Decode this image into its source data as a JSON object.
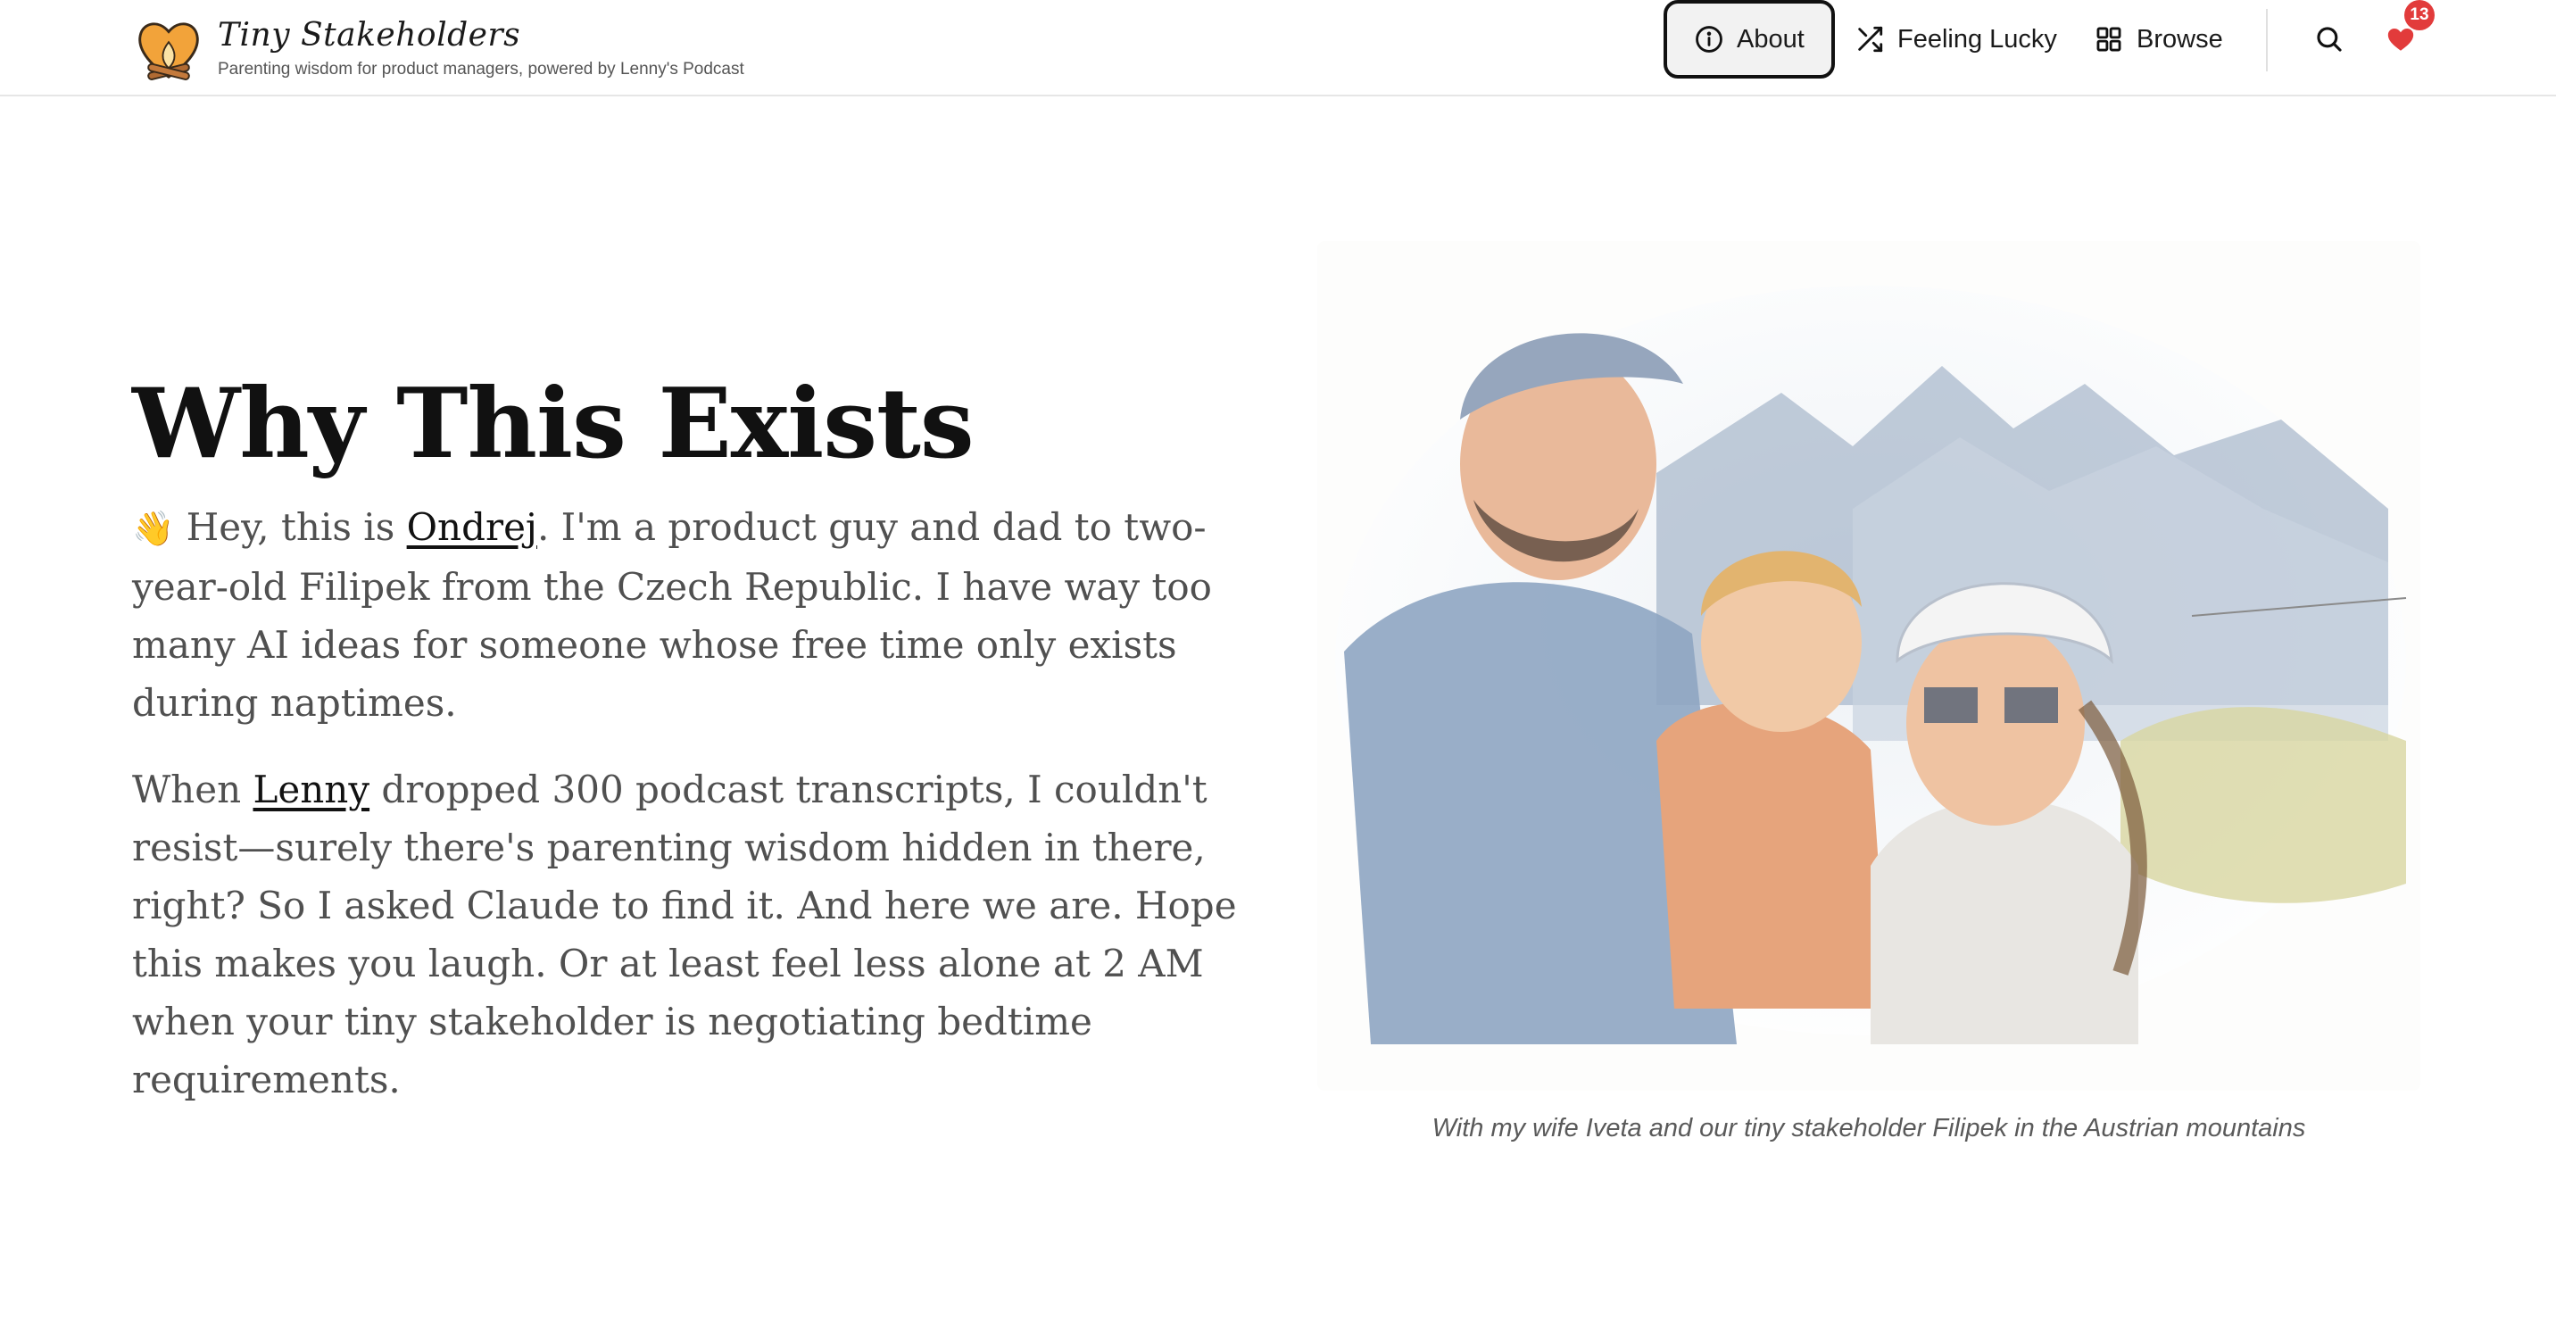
{
  "brand": {
    "title": "Tiny Stakeholders",
    "tagline": "Parenting wisdom for product managers, powered by Lenny's Podcast",
    "logo_icon": "heart-campfire-icon"
  },
  "nav": {
    "about": "About",
    "feeling_lucky": "Feeling Lucky",
    "browse": "Browse",
    "favorites_count": "13"
  },
  "colors": {
    "accent_red": "#e23b3b",
    "text_dark": "#111111",
    "text_body": "#505050"
  },
  "main": {
    "title": "Why This Exists",
    "p1": {
      "emoji": "👋",
      "before_link": " Hey, this is ",
      "link": "Ondrej",
      "after_link": ". I'm a product guy and dad to two-year-old Filipek from the Czech Republic. I have way too many AI ideas for someone whose free time only exists during naptimes."
    },
    "p2": {
      "before_link": "When ",
      "link": "Lenny",
      "after_link": " dropped 300 podcast transcripts, I couldn't resist—surely there's parenting wisdom hidden in there, right? So I asked Claude to find it. And here we are. Hope this makes you laugh. Or at least feel less alone at 2 AM when your tiny stakeholder is negotiating bedtime requirements."
    },
    "photo_caption": "With my wife Iveta and our tiny stakeholder Filipek in the Austrian mountains"
  }
}
